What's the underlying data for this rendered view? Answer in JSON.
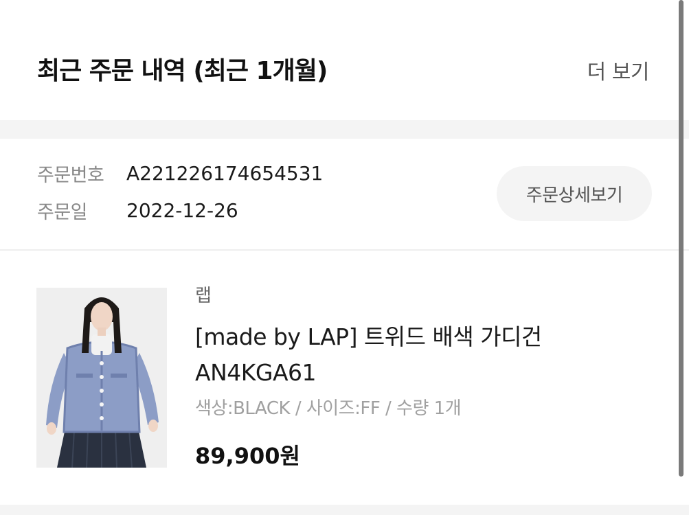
{
  "header": {
    "title": "최근 주문 내역 (최근 1개월)",
    "more_label": "더 보기"
  },
  "order": {
    "number_label": "주문번호",
    "number_value": "A221226174654531",
    "date_label": "주문일",
    "date_value": "2022-12-26",
    "detail_button_label": "주문상세보기"
  },
  "product": {
    "brand": "랩",
    "name": "[made by LAP] 트위드 배색 가디건 AN4KGA61",
    "options": "색상:BLACK / 사이즈:FF / 수량 1개",
    "price": "89,900원",
    "colors": {
      "cardigan": "#8c9dc6",
      "skirt": "#2a3140",
      "background": "#efefef"
    }
  }
}
